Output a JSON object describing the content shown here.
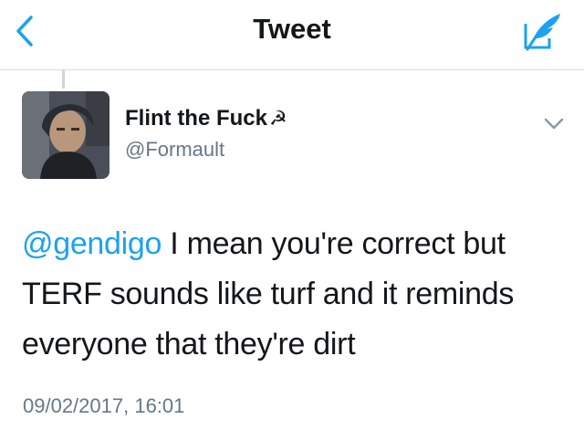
{
  "nav": {
    "title": "Tweet",
    "back_icon": "chevron-left-icon",
    "compose_icon": "compose-tweet-icon",
    "accent_color": "#1da1f2"
  },
  "tweet": {
    "author": {
      "display_name": "Flint the Fuck",
      "name_emoji": "☭",
      "handle": "@Formault",
      "avatar": "profile-photo"
    },
    "mention": "@gendigo",
    "text": " I mean you're correct but TERF sounds like turf and it reminds everyone that they're dirt",
    "timestamp": "09/02/2017, 16:01"
  }
}
